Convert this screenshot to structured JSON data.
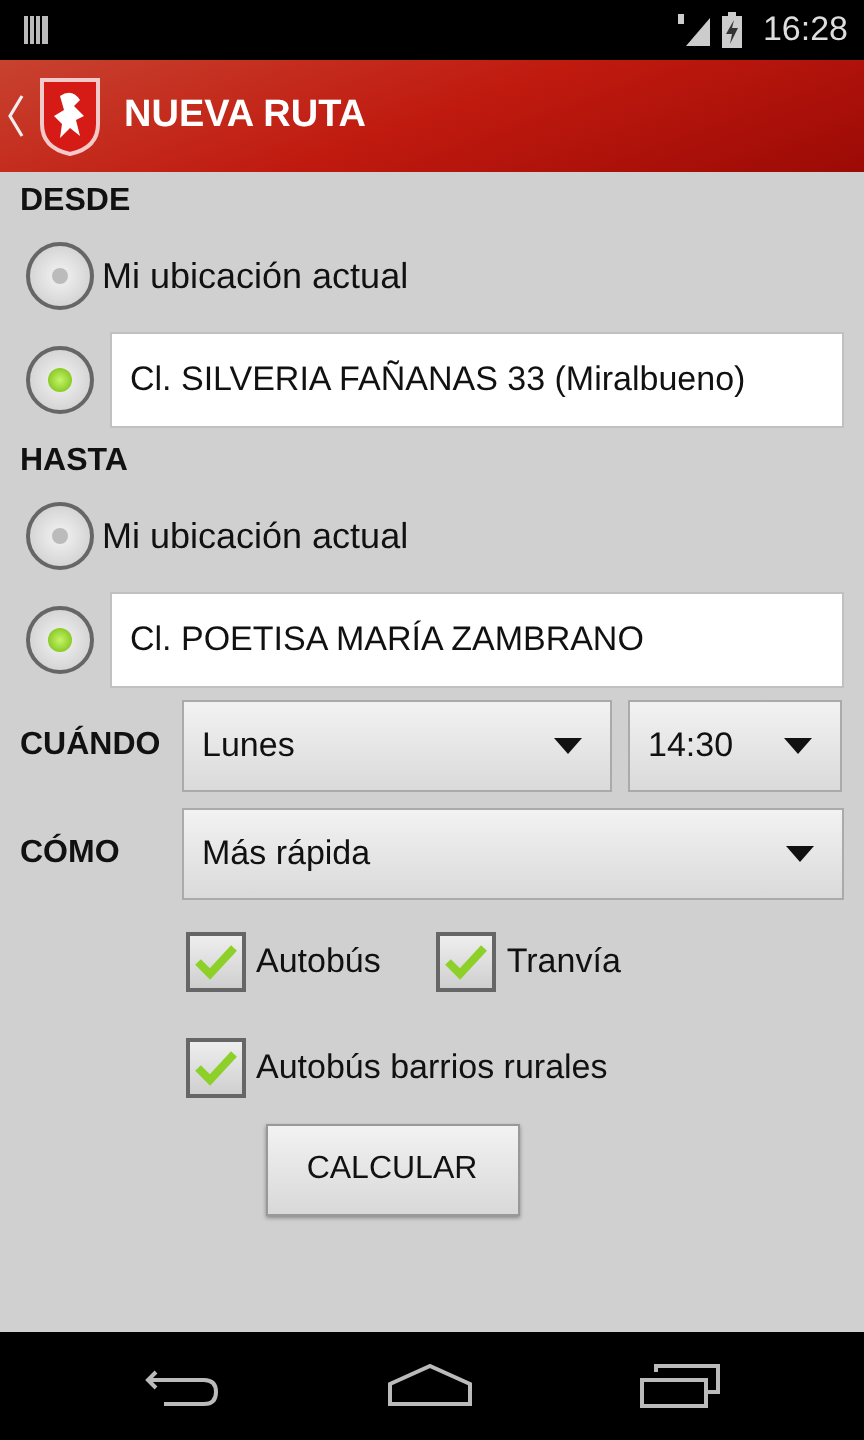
{
  "status_bar": {
    "time": "16:28"
  },
  "action_bar": {
    "title": "NUEVA RUTA"
  },
  "sections": [
    {
      "label": "DESDE",
      "options": [
        {
          "kind": "current",
          "label": "Mi ubicación actual",
          "selected": false
        },
        {
          "kind": "address",
          "value": "Cl. SILVERIA FAÑANAS 33 (Miralbueno)",
          "selected": true
        }
      ]
    },
    {
      "label": "HASTA",
      "options": [
        {
          "kind": "current",
          "label": "Mi ubicación actual",
          "selected": false
        },
        {
          "kind": "address",
          "value": "Cl. POETISA MARÍA ZAMBRANO",
          "selected": true
        }
      ]
    }
  ],
  "when": {
    "label": "CUÁNDO",
    "day": "Lunes",
    "time": "14:30"
  },
  "how": {
    "label": "CÓMO",
    "value": "Más rápida"
  },
  "transport_rows": [
    {
      "items": [
        {
          "label": "Autobús",
          "checked": true
        },
        {
          "label": "Tranvía",
          "checked": true
        }
      ]
    },
    {
      "items": [
        {
          "label": "Autobús barrios rurales",
          "checked": true
        }
      ]
    }
  ],
  "button": "CALCULAR"
}
